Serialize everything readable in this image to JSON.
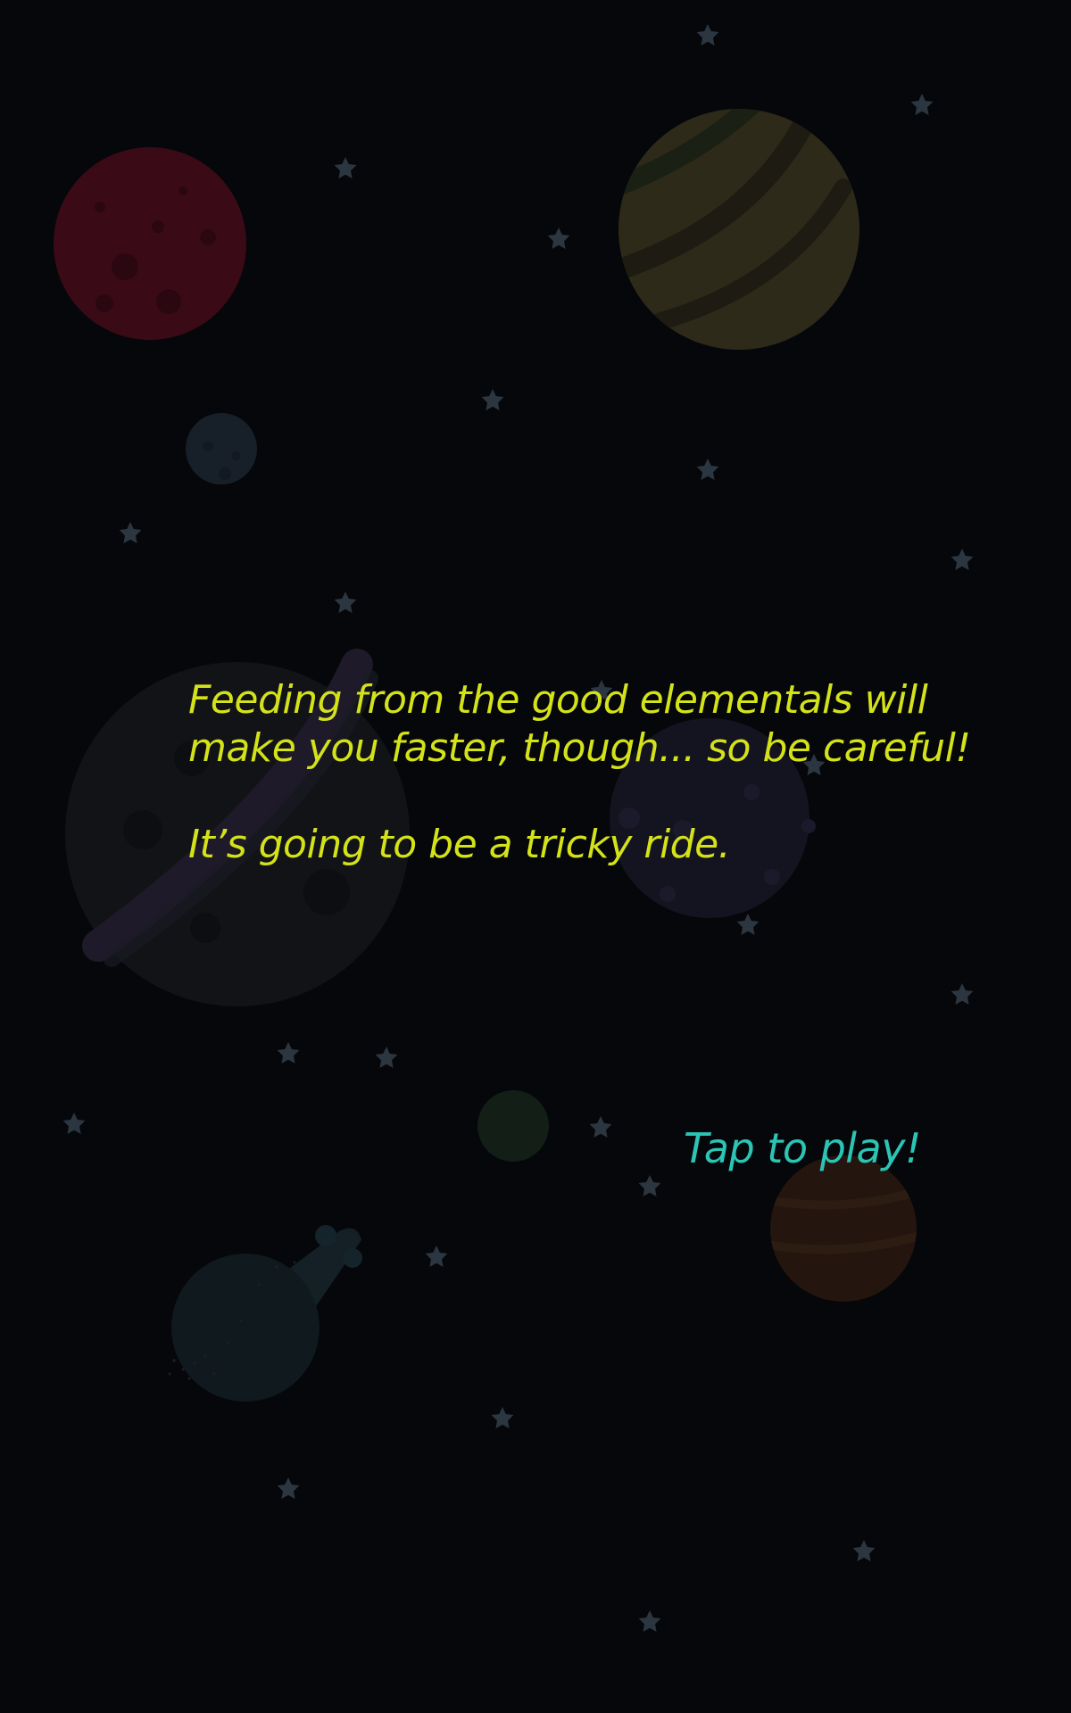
{
  "intro": {
    "line1": "Feeding from the good elementals will",
    "line2": "make you faster, though... so be careful!",
    "line3": "It’s going to be a tricky ride."
  },
  "tap_prompt": "Tap to play!",
  "colors": {
    "background": "#05070a",
    "message_text": "#d4e21a",
    "tap_text": "#2cc4b4",
    "star": "#2c3640"
  },
  "icons": {
    "star": "star-icon",
    "planets": [
      "red-cratered-planet-icon",
      "striped-gas-giant-icon",
      "small-blue-moon-icon",
      "ringed-planet-icon",
      "purple-cratered-planet-icon",
      "small-green-planet-icon",
      "brown-banded-planet-icon",
      "comet-planet-icon"
    ]
  }
}
